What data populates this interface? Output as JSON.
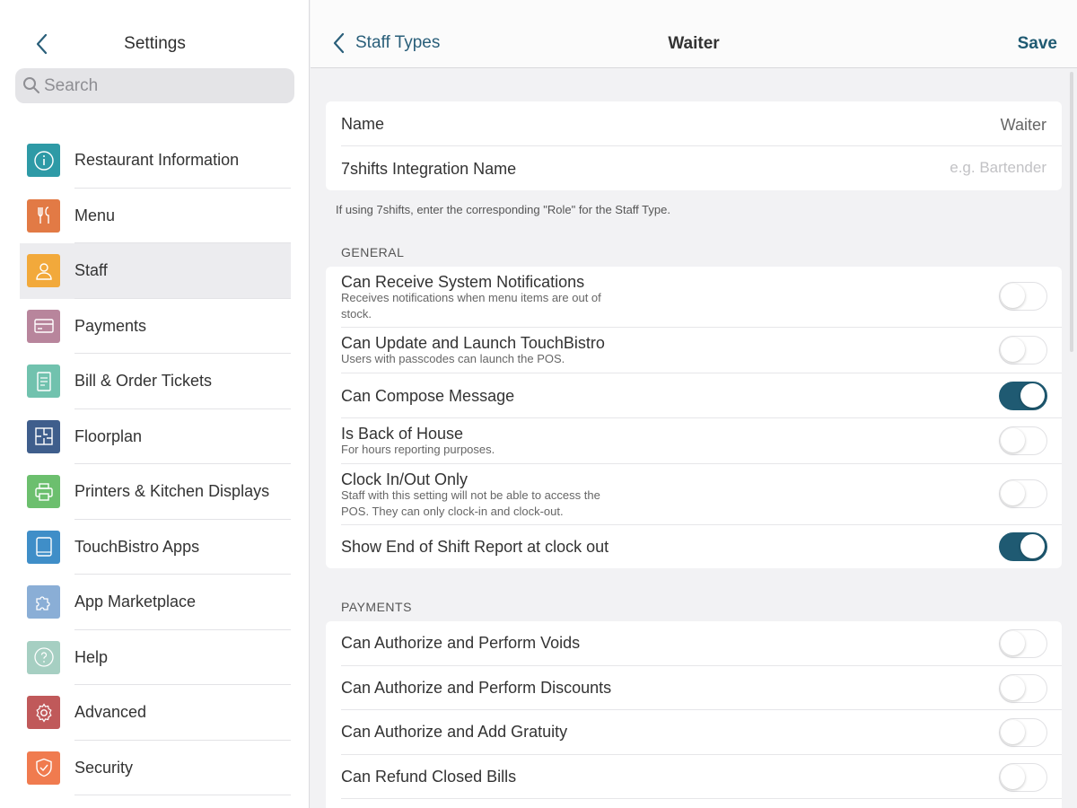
{
  "sidebar": {
    "title": "Settings",
    "search_placeholder": "Search",
    "items": [
      {
        "label": "Restaurant Information",
        "icon": "info-icon",
        "color": "#2e9aa6"
      },
      {
        "label": "Menu",
        "icon": "utensils-icon",
        "color": "#e27a45"
      },
      {
        "label": "Staff",
        "icon": "person-icon",
        "color": "#f2a93b"
      },
      {
        "label": "Payments",
        "icon": "card-icon",
        "color": "#b8859c"
      },
      {
        "label": "Bill & Order Tickets",
        "icon": "receipt-icon",
        "color": "#71c2ae"
      },
      {
        "label": "Floorplan",
        "icon": "floorplan-icon",
        "color": "#3f5e8c"
      },
      {
        "label": "Printers & Kitchen Displays",
        "icon": "printer-icon",
        "color": "#6cbf6e"
      },
      {
        "label": "TouchBistro Apps",
        "icon": "tablet-icon",
        "color": "#3f8ec8"
      },
      {
        "label": "App Marketplace",
        "icon": "puzzle-icon",
        "color": "#8aaed6"
      },
      {
        "label": "Help",
        "icon": "help-icon",
        "color": "#a6cfc2"
      },
      {
        "label": "Advanced",
        "icon": "gear-icon",
        "color": "#c0595a"
      },
      {
        "label": "Security",
        "icon": "shield-icon",
        "color": "#f07b4f"
      }
    ],
    "selected_index": 2
  },
  "header": {
    "back_label": "Staff Types",
    "title": "Waiter",
    "save_label": "Save"
  },
  "name_card": {
    "name_label": "Name",
    "name_value": "Waiter",
    "integration_label": "7shifts Integration Name",
    "integration_placeholder": "e.g. Bartender",
    "footnote": "If using 7shifts, enter the corresponding \"Role\" for the Staff Type."
  },
  "general": {
    "section_label": "GENERAL",
    "rows": [
      {
        "title": "Can Receive System Notifications",
        "subtitle": "Receives notifications when menu items are out of stock.",
        "on": false
      },
      {
        "title": "Can Update and Launch TouchBistro",
        "subtitle": "Users with passcodes can launch the POS.",
        "on": false
      },
      {
        "title": "Can Compose Message",
        "subtitle": "",
        "on": true
      },
      {
        "title": "Is Back of House",
        "subtitle": "For hours reporting purposes.",
        "on": false
      },
      {
        "title": "Clock In/Out Only",
        "subtitle": "Staff with this setting will not be able to access the POS. They can only clock-in and clock-out.",
        "on": false
      },
      {
        "title": "Show End of Shift Report at clock out",
        "subtitle": "",
        "on": true
      }
    ]
  },
  "payments": {
    "section_label": "PAYMENTS",
    "rows": [
      {
        "title": "Can Authorize and Perform Voids",
        "on": false
      },
      {
        "title": "Can Authorize and Perform Discounts",
        "on": false
      },
      {
        "title": "Can Authorize and Add Gratuity",
        "on": false
      },
      {
        "title": "Can Refund Closed Bills",
        "on": false
      }
    ]
  },
  "colors": {
    "accent": "#1f5a72",
    "link": "#2a5f7a"
  }
}
